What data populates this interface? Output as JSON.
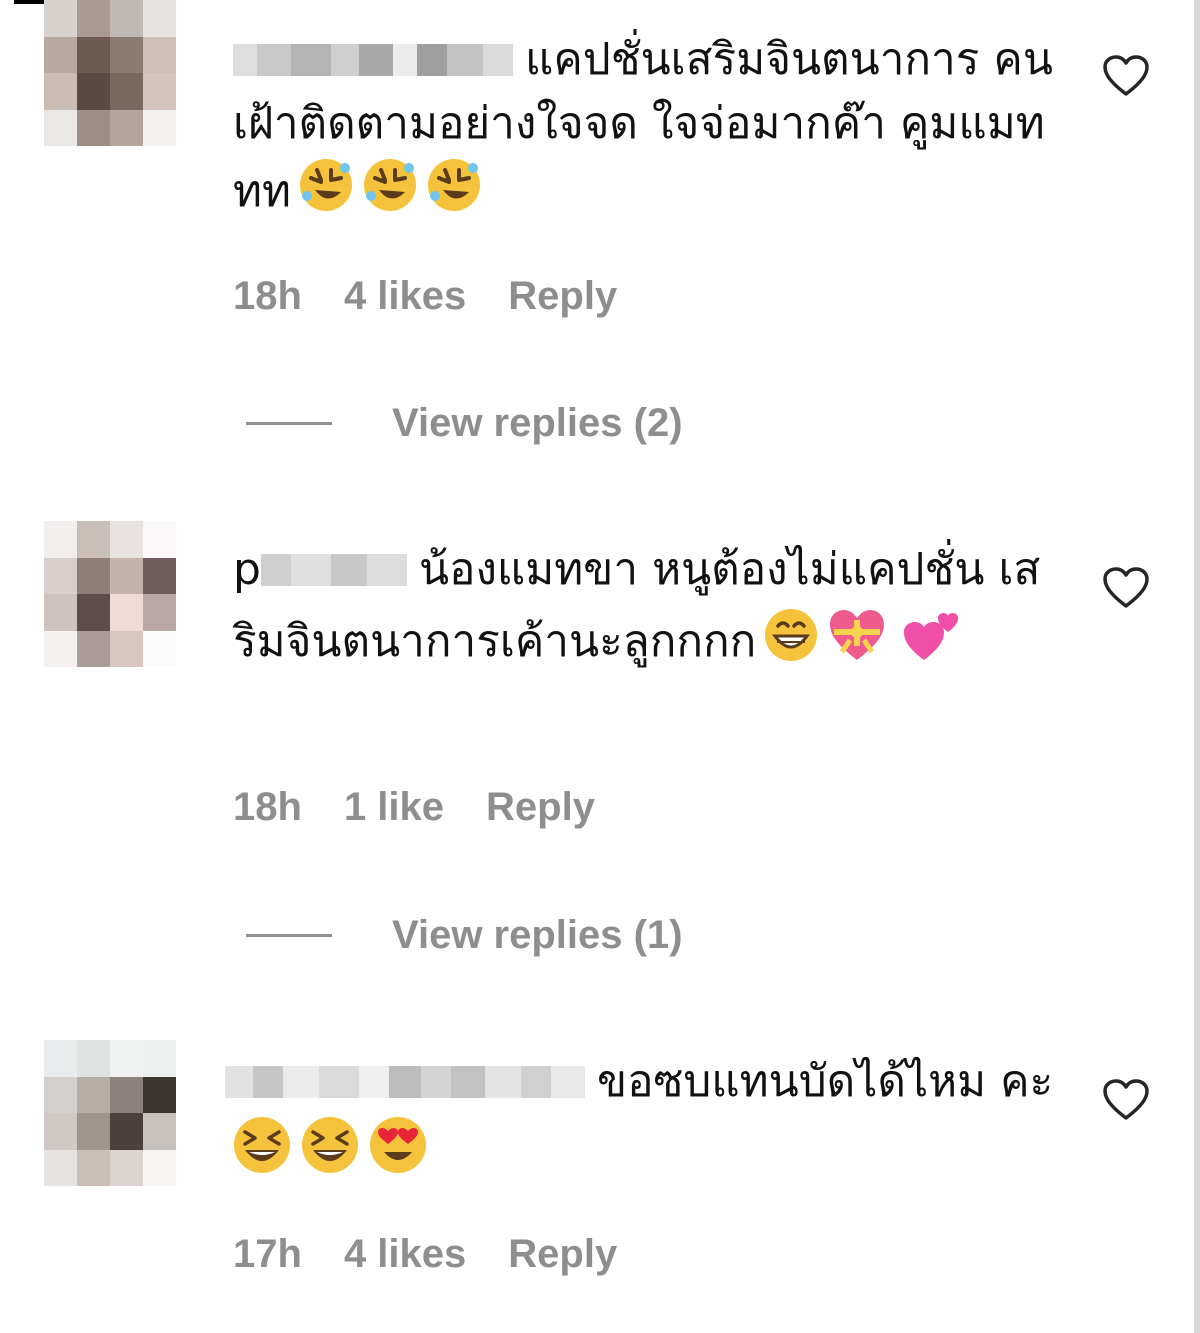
{
  "comments": [
    {
      "text_line1": "แคปชั่นเสริมจินตนาการ",
      "text_rest": "คนเฝ้าติดตามอย่างใจจด ใจจ่อมากค๊า คูมแมททท",
      "emoji_names": [
        "rolling-on-floor-laughing",
        "rolling-on-floor-laughing",
        "rolling-on-floor-laughing"
      ],
      "time": "18h",
      "likes": "4 likes",
      "reply_label": "Reply",
      "view_replies": "View replies (2)"
    },
    {
      "username_visible": "p",
      "text_line1": "น้องแมทขา หนูต้องไม่แคปชั่น",
      "text_rest": "เสริมจินตนาการเค้านะลูกกกก",
      "emoji_names": [
        "grinning-face",
        "heart-with-ribbon",
        "two-hearts"
      ],
      "time": "18h",
      "likes": "1 like",
      "reply_label": "Reply",
      "view_replies": "View replies (1)"
    },
    {
      "text_line1": "ขอซบแทนบัดได้ไหม",
      "text_rest": "คะ",
      "emoji_names": [
        "grinning-squinting-face",
        "grinning-squinting-face",
        "heart-eyes-face"
      ],
      "time": "17h",
      "likes": "4 likes",
      "reply_label": "Reply"
    }
  ],
  "icons": {
    "like": "heart-outline-icon"
  },
  "colors": {
    "meta_gray": "#8e8e8e",
    "text": "#111111",
    "background": "#ffffff"
  }
}
